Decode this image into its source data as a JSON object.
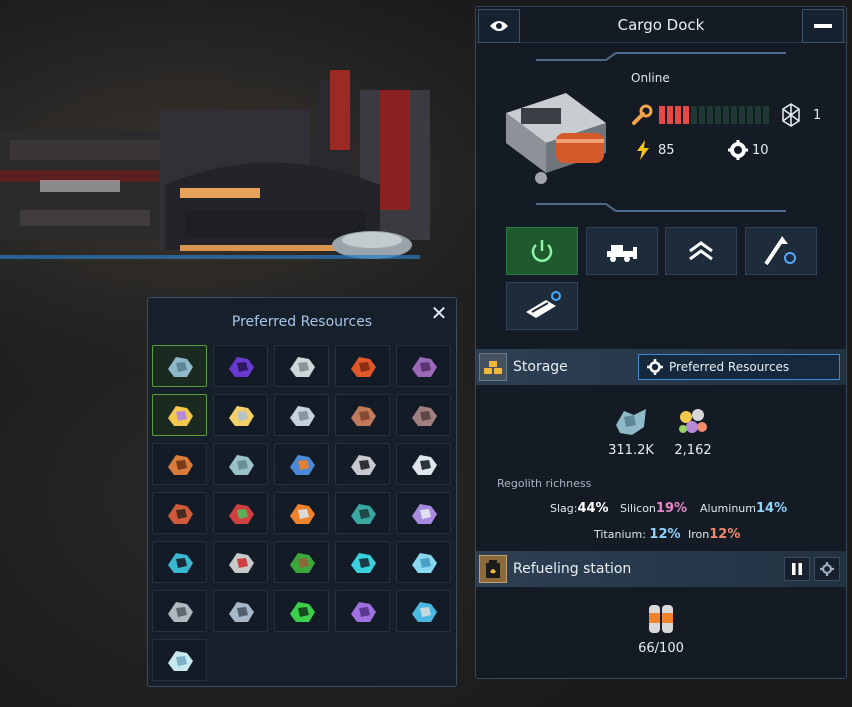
{
  "preferred_popup": {
    "title": "Preferred Resources",
    "close_icon": "close-icon"
  },
  "resource_grid": [
    [
      "slag-icon",
      "purple-crystal-tube-icon",
      "silicon-ore-icon",
      "copper-ore-icon",
      "purple-ore-icon"
    ],
    [
      "regolith-mix-icon",
      "gold-ingot-icon",
      "steel-pipes-icon",
      "bricks-icon",
      "iron-bar-icon"
    ],
    [
      "gears-icon",
      "glass-pane-icon",
      "battery-cells-icon",
      "capsule-icon",
      "frame-cube-icon"
    ],
    [
      "cable-spool-icon",
      "circuit-board-icon",
      "fuel-canisters-icon",
      "teal-crystal-icon",
      "purple-crate-icon"
    ],
    [
      "cryo-device-icon",
      "metal-crate-icon",
      "hydroponics-box-icon",
      "cyan-orb-icon",
      "ice-crystal-icon"
    ],
    [
      "steel-rods-icon",
      "plates-icon",
      "green-chip-icon",
      "violet-capsule-icon",
      "coolant-tanks-icon"
    ],
    [
      "ice-chunk-icon"
    ]
  ],
  "panel": {
    "title": "Cargo Dock",
    "eye_icon": "eye-icon",
    "minimize_icon": "minimize-icon",
    "status": "Online",
    "health": {
      "filled": 4,
      "total": 14
    },
    "frame_count": "1",
    "power": "85",
    "workers": "10",
    "actions": [
      "power-button",
      "bulldozer-button",
      "upgrade-button",
      "relocate-button",
      "conveyor-settings-button"
    ]
  },
  "storage": {
    "label": "Storage",
    "preferred_button": "Preferred Resources",
    "items": [
      {
        "icon": "slag-icon",
        "amount": "311.2K"
      },
      {
        "icon": "regolith-mix-icon",
        "amount": "2,162"
      }
    ],
    "richness_label": "Regolith richness",
    "richness": [
      {
        "name": "Slag:",
        "value": "44%",
        "color": "#ffffff"
      },
      {
        "name": "Silicon",
        "value": "19%",
        "color": "#e889c6"
      },
      {
        "name": "Aluminum",
        "value": "14%",
        "color": "#8fd4ff"
      },
      {
        "name": "Titanium:",
        "value": "12%",
        "color": "#8fd4ff"
      },
      {
        "name": "Iron",
        "value": "12%",
        "color": "#f08a6a"
      }
    ]
  },
  "refueling": {
    "label": "Refueling station",
    "amount": "66/100"
  }
}
